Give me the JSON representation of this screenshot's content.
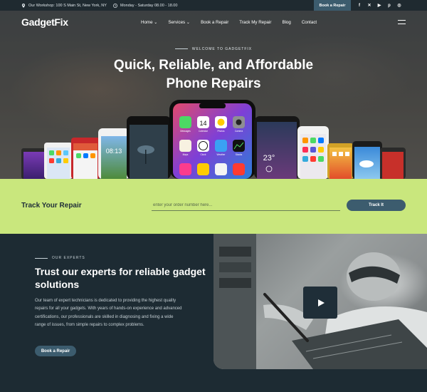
{
  "topbar": {
    "address": "Our Workshop: 100 S Main St, New York, NY",
    "hours": "Monday - Saturday 08.00 - 18.00",
    "book_label": "Book a Repair",
    "social_icons": [
      "facebook-icon",
      "x-icon",
      "youtube-icon",
      "pinterest-icon",
      "instagram-icon"
    ]
  },
  "brand": {
    "logo": "GadgetFix"
  },
  "nav": {
    "items": [
      {
        "label": "Home",
        "dropdown": true
      },
      {
        "label": "Services",
        "dropdown": true
      },
      {
        "label": "Book a Repair",
        "dropdown": false
      },
      {
        "label": "Track My Repair",
        "dropdown": false
      },
      {
        "label": "Blog",
        "dropdown": false
      },
      {
        "label": "Contact",
        "dropdown": false
      }
    ]
  },
  "hero": {
    "eyebrow": "WELCOME TO GADGETFIX",
    "title_line1": "Quick, Reliable, and Affordable",
    "title_line2": "Phone Repairs",
    "center_phone": {
      "apps": [
        "Messages",
        "Calendar",
        "Photos",
        "Camera",
        "Maps",
        "Clock",
        "Weather",
        "Stocks",
        "iTunes",
        "Notes",
        "Calculator",
        "News"
      ],
      "calendar_day": "14"
    },
    "right_phone": {
      "time": "23°"
    },
    "left_phone": {
      "time": "08:13"
    }
  },
  "track": {
    "title": "Track Your Repair",
    "placeholder": "enter your order number here...",
    "button": "Track It"
  },
  "experts": {
    "eyebrow": "OUR EXPERTS",
    "title": "Trust our experts for reliable gadget solutions",
    "body": "Our team of expert technicians is dedicated to providing the highest quality repairs for all your gadgets. With years of hands-on experience and advanced certifications, our professionals are skilled in diagnosing and fixing a wide range of issues, from simple repairs to complex problems.",
    "cta": "Book a Repair"
  },
  "colors": {
    "accent": "#3c5c6e",
    "lime": "#c9e77d",
    "dark": "#1d2b33"
  }
}
